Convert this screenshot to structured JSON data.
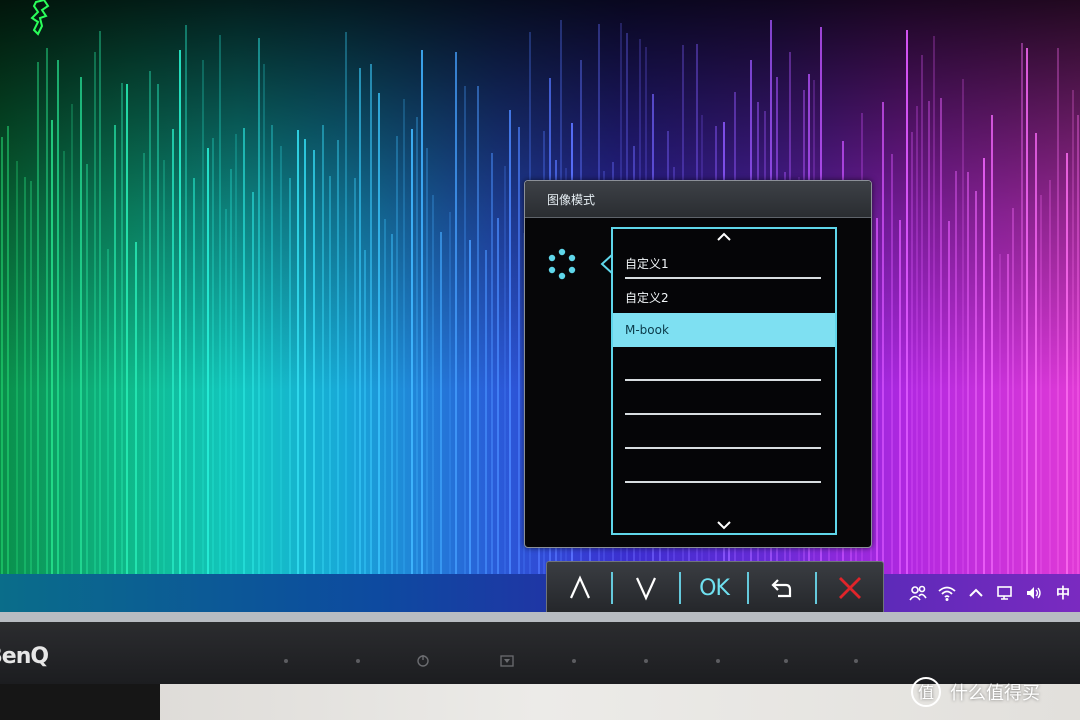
{
  "osd": {
    "title": "图像模式",
    "icon": "picture-mode-icon",
    "list": {
      "items": [
        {
          "label": "自定义1",
          "selected": false
        },
        {
          "label": "自定义2",
          "selected": false
        },
        {
          "label": "M-book",
          "selected": true
        },
        {
          "label": "",
          "selected": false
        },
        {
          "label": "",
          "selected": false
        },
        {
          "label": "",
          "selected": false
        },
        {
          "label": "",
          "selected": false
        }
      ]
    }
  },
  "hotkeys": {
    "up": "up-arrow-icon",
    "down": "down-arrow-icon",
    "ok": "OK",
    "back": "back-arrow-icon",
    "exit": "close-icon"
  },
  "tray": {
    "lang": "中"
  },
  "monitor": {
    "brand": "BenQ"
  },
  "watermark": {
    "text": "什么值得买"
  },
  "colors": {
    "accent": "#5fd6ea",
    "selected_row": "#7ee0f2",
    "exit_red": "#e0242a"
  }
}
